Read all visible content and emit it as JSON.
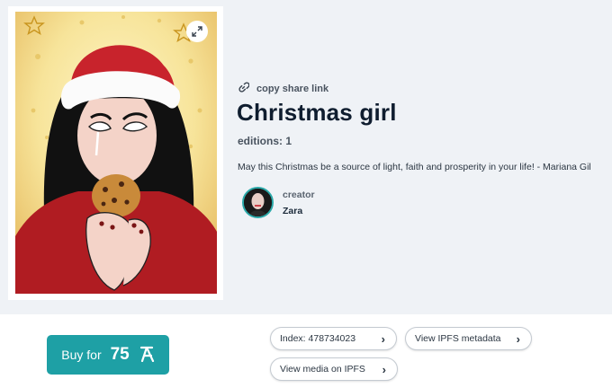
{
  "artwork": {
    "title": "Christmas girl",
    "editions_label": "editions: 1",
    "description": "May this Christmas be a source of light, faith and prosperity in your life! - Mariana Gil",
    "share_label": "copy share link"
  },
  "creator": {
    "label": "creator",
    "name": "Zara"
  },
  "purchase": {
    "label": "Buy for",
    "price": "75"
  },
  "links": {
    "index": "Index: 478734023",
    "ipfs_metadata": "View IPFS metadata",
    "ipfs_media": "View media on IPFS"
  },
  "icons": {
    "expand": "expand-icon",
    "share": "link-icon",
    "currency": "tezos-icon",
    "chevron": "chevron-right-icon"
  },
  "colors": {
    "accent": "#1ea0a5",
    "page_bg": "#eff2f6",
    "title": "#0f1d2f"
  }
}
